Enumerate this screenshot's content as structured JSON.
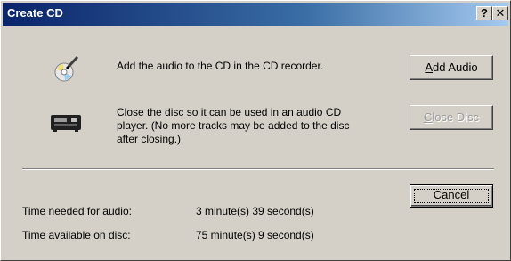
{
  "window": {
    "title": "Create CD"
  },
  "titlebar": {
    "help_label": "?",
    "close_label": "✕"
  },
  "steps": [
    {
      "icon": "cd-pen-icon",
      "text": "Add the audio to the CD in the CD recorder."
    },
    {
      "icon": "cd-player-icon",
      "text": "Close the disc so it can be used in an audio CD player.  (No more tracks may be added to the disc after closing.)"
    }
  ],
  "buttons": {
    "add_audio": {
      "accel": "A",
      "rest": "dd Audio"
    },
    "close_disc": {
      "accel": "C",
      "rest": "lose Disc"
    },
    "cancel": "Cancel"
  },
  "info": {
    "needed_label": "Time needed for audio:",
    "needed_value": "3 minute(s) 39 second(s)",
    "available_label": "Time available on disc:",
    "available_value": "75 minute(s) 9 second(s)"
  }
}
